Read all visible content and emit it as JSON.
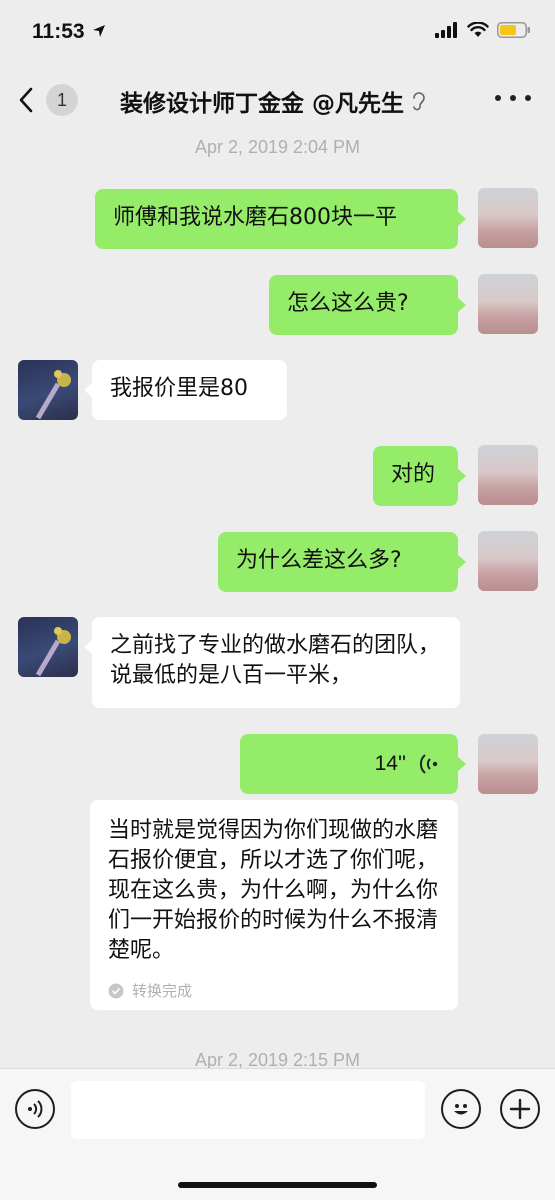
{
  "status_bar": {
    "time": "11:53"
  },
  "header": {
    "back_count": "1",
    "title": "装修设计师丁金金 @凡先生"
  },
  "timestamps": [
    "Apr 2, 2019 2:04 PM",
    "Apr 2, 2019 2:15 PM"
  ],
  "messages": [
    {
      "sender": "me",
      "text": "师傅和我说水磨石800块一平"
    },
    {
      "sender": "me",
      "text": "怎么这么贵?"
    },
    {
      "sender": "other",
      "text": "我报价里是80"
    },
    {
      "sender": "me",
      "text": "对的"
    },
    {
      "sender": "me",
      "text": "为什么差这么多?"
    },
    {
      "sender": "other",
      "text": "之前找了专业的做水磨石的团队，说最低的是八百一平米，"
    }
  ],
  "voice_message": {
    "duration": "14''",
    "transcript": "当时就是觉得因为你们现做的水磨石报价便宜，所以才选了你们呢，现在这么贵，为什么啊，为什么你们一开始报价的时候为什么不报清楚呢。",
    "transcript_status": "转换完成"
  },
  "colors": {
    "sent_bubble": "#95ec69",
    "received_bubble": "#ffffff",
    "background": "#ededed"
  },
  "icons": [
    "navigation-arrow-icon",
    "signal-icon",
    "wifi-icon",
    "battery-icon",
    "back-chevron-icon",
    "ear-icon",
    "more-icon",
    "voice-wave-icon",
    "check-circle-icon",
    "voice-input-icon",
    "emoji-icon",
    "plus-icon"
  ]
}
